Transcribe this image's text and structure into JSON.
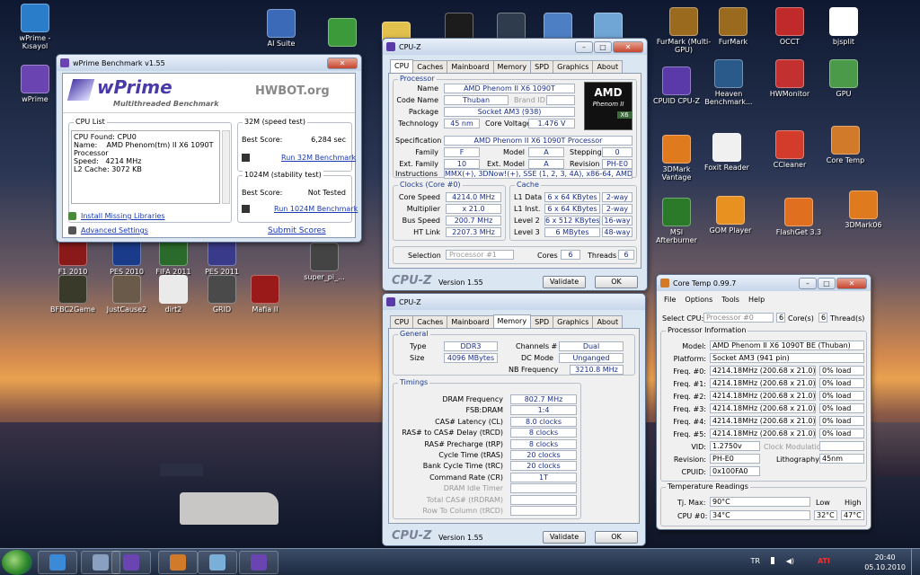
{
  "desktop_icons": [
    {
      "name": "wprime-kisayol-icon",
      "label": "wPrime - Kısayol",
      "color": "#2a7dc9"
    },
    {
      "name": "wprime-icon",
      "label": "wPrime",
      "color": "#6a44b0"
    },
    {
      "name": "ai-suite-icon",
      "label": "AI Suite",
      "color": "#3a6ab8"
    },
    {
      "name": "chrome-icon",
      "label": "",
      "color": "#3d9a3a"
    },
    {
      "name": "folder-icon",
      "label": "",
      "color": "#e2c14c"
    },
    {
      "name": "amd-icon",
      "label": "",
      "color": "#1c1c1c"
    },
    {
      "name": "steam-icon",
      "label": "",
      "color": "#2f3c4e"
    },
    {
      "name": "app-icon-1",
      "label": "",
      "color": "#4d7fc4"
    },
    {
      "name": "app-icon-2",
      "label": "",
      "color": "#70a6d6"
    },
    {
      "name": "furmark-multi-gpu-icon",
      "label": "FurMark (Multi-GPU)",
      "color": "#9a6a1e"
    },
    {
      "name": "furmark-icon",
      "label": "FurMark",
      "color": "#9a6a1e"
    },
    {
      "name": "occt-icon",
      "label": "OCCT",
      "color": "#c12a2a"
    },
    {
      "name": "bjsplit-icon",
      "label": "bjsplit",
      "color": "#ffffff"
    },
    {
      "name": "cpu-z-icon",
      "label": "CPUID CPU-Z",
      "color": "#5a3aa8"
    },
    {
      "name": "heaven-benchmark-icon",
      "label": "Heaven Benchmark...",
      "color": "#2a5a8a"
    },
    {
      "name": "hwmonitor-icon",
      "label": "HWMonitor",
      "color": "#c23030"
    },
    {
      "name": "gpu-icon",
      "label": "GPU",
      "color": "#4a9a4a"
    },
    {
      "name": "3dmark-vantage-icon",
      "label": "3DMark Vantage",
      "color": "#e07a1e"
    },
    {
      "name": "foxit-reader-icon",
      "label": "Foxit Reader",
      "color": "#f0f0f0"
    },
    {
      "name": "ccleaner-icon",
      "label": "CCleaner",
      "color": "#d33b2a"
    },
    {
      "name": "core-temp-icon",
      "label": "Core Temp",
      "color": "#d07a2a"
    },
    {
      "name": "msi-afterburner-icon",
      "label": "MSI Afterburner",
      "color": "#2a7a2a"
    },
    {
      "name": "gom-player-icon",
      "label": "GOM Player",
      "color": "#e89020"
    },
    {
      "name": "flashget-icon",
      "label": "FlashGet 3.3",
      "color": "#e07020"
    },
    {
      "name": "3dmark06-icon",
      "label": "3DMark06",
      "color": "#e07a1e"
    },
    {
      "name": "f1-2010-icon",
      "label": "F1 2010",
      "color": "#8a1a1a"
    },
    {
      "name": "pes-2010-icon",
      "label": "PES 2010",
      "color": "#1a3a8a"
    },
    {
      "name": "fifa-2011-icon",
      "label": "FIFA 2011",
      "color": "#2a6a2a"
    },
    {
      "name": "pes-2011-icon",
      "label": "PES 2011",
      "color": "#3a3a8a"
    },
    {
      "name": "super-pi-icon",
      "label": "super_pi_...",
      "color": "#444"
    },
    {
      "name": "bfbc2game-icon",
      "label": "BFBC2Game",
      "color": "#3a3a2a"
    },
    {
      "name": "justcause2-icon",
      "label": "JustCause2",
      "color": "#6a5a4a"
    },
    {
      "name": "dirt2-icon",
      "label": "dirt2",
      "color": "#eaeaea"
    },
    {
      "name": "grid-icon",
      "label": "GRID",
      "color": "#4a4a4a"
    },
    {
      "name": "mafia-ii-icon",
      "label": "Mafia II",
      "color": "#9a1a1a"
    }
  ],
  "wprime": {
    "title": "wPrime Benchmark v1.55",
    "logo": "wPrime",
    "logo_sub": "Multithreaded Benchmark",
    "hwbot": "HWBOT.org",
    "cpu_list_label": "CPU List",
    "cpu_lines": [
      "CPU Found: CPU0",
      "Name:    AMD Phenom(tm) II X6 1090T",
      "Processor",
      "Speed:   4214 MHz",
      "L2 Cache: 3072 KB"
    ],
    "speed_test_label": "32M (speed test)",
    "stability_test_label": "1024M (stability test)",
    "best_score_label": "Best Score:",
    "best_32m": "6,284 sec",
    "best_1024m": "Not Tested",
    "run_32m": "Run 32M Benchmark",
    "run_1024m": "Run 1024M Benchmark",
    "install_libs": "Install Missing Libraries",
    "advanced": "Advanced Settings",
    "submit": "Submit Scores"
  },
  "cpuz1": {
    "title": "CPU-Z",
    "tabs": [
      "CPU",
      "Caches",
      "Mainboard",
      "Memory",
      "SPD",
      "Graphics",
      "About"
    ],
    "processor_label": "Processor",
    "name_label": "Name",
    "name": "AMD Phenom II X6 1090T",
    "codename_label": "Code Name",
    "codename": "Thuban",
    "brandid_label": "Brand ID",
    "package_label": "Package",
    "package": "Socket AM3 (938)",
    "tech_label": "Technology",
    "tech": "45 nm",
    "voltage_label": "Core Voltage",
    "voltage": "1.476 V",
    "spec_label": "Specification",
    "spec": "AMD Phenom II X6 1090T Processor",
    "family_label": "Family",
    "family": "F",
    "model_label": "Model",
    "model": "A",
    "stepping_label": "Stepping",
    "stepping": "0",
    "extfamily_label": "Ext. Family",
    "extfamily": "10",
    "extmodel_label": "Ext. Model",
    "extmodel": "A",
    "revision_label": "Revision",
    "revision": "PH-E0",
    "instr_label": "Instructions",
    "instr": "MMX(+), 3DNow!(+), SSE (1, 2, 3, 4A), x86-64, AMD-V",
    "amd_logo": "AMD",
    "phenom_logo": "Phenom II",
    "x6": "X6",
    "clocks_label": "Clocks (Core #0)",
    "corespeed_label": "Core Speed",
    "corespeed": "4214.0 MHz",
    "multiplier_label": "Multiplier",
    "multiplier": "x 21.0",
    "busspeed_label": "Bus Speed",
    "busspeed": "200.7 MHz",
    "htlink_label": "HT Link",
    "htlink": "2207.3 MHz",
    "cache_label": "Cache",
    "l1d_label": "L1 Data",
    "l1d": "6 x 64 KBytes",
    "l1d_w": "2-way",
    "l1i_label": "L1 Inst.",
    "l1i": "6 x 64 KBytes",
    "l1i_w": "2-way",
    "l2_label": "Level 2",
    "l2": "6 x 512 KBytes",
    "l2_w": "16-way",
    "l3_label": "Level 3",
    "l3": "6 MBytes",
    "l3_w": "48-way",
    "selection_label": "Selection",
    "selection": "Processor #1",
    "cores_label": "Cores",
    "cores": "6",
    "threads_label": "Threads",
    "threads": "6",
    "brand": "CPU-Z",
    "version": "Version 1.55",
    "validate": "Validate",
    "ok": "OK"
  },
  "cpuz2": {
    "title": "CPU-Z",
    "tabs": [
      "CPU",
      "Caches",
      "Mainboard",
      "Memory",
      "SPD",
      "Graphics",
      "About"
    ],
    "general_label": "General",
    "type_label": "Type",
    "type": "DDR3",
    "size_label": "Size",
    "size": "4096 MBytes",
    "channels_label": "Channels #",
    "channels": "Dual",
    "dcmode_label": "DC Mode",
    "dcmode": "Unganged",
    "nbfreq_label": "NB Frequency",
    "nbfreq": "3210.8 MHz",
    "timings_label": "Timings",
    "timings": [
      {
        "label": "DRAM Frequency",
        "value": "802.7 MHz"
      },
      {
        "label": "FSB:DRAM",
        "value": "1:4"
      },
      {
        "label": "CAS# Latency (CL)",
        "value": "8.0 clocks"
      },
      {
        "label": "RAS# to CAS# Delay (tRCD)",
        "value": "8 clocks"
      },
      {
        "label": "RAS# Precharge (tRP)",
        "value": "8 clocks"
      },
      {
        "label": "Cycle Time (tRAS)",
        "value": "20 clocks"
      },
      {
        "label": "Bank Cycle Time (tRC)",
        "value": "20 clocks"
      },
      {
        "label": "Command Rate (CR)",
        "value": "1T"
      },
      {
        "label": "DRAM Idle Timer",
        "value": ""
      },
      {
        "label": "Total CAS# (tRDRAM)",
        "value": ""
      },
      {
        "label": "Row To Column (tRCD)",
        "value": ""
      }
    ],
    "brand": "CPU-Z",
    "version": "Version 1.55",
    "validate": "Validate",
    "ok": "OK"
  },
  "coretemp": {
    "title": "Core Temp 0.99.7",
    "menu": [
      "File",
      "Options",
      "Tools",
      "Help"
    ],
    "selectcpu_label": "Select CPU:",
    "selectcpu": "Processor #0",
    "cores_n": "6",
    "cores_label": "Core(s)",
    "threads_n": "6",
    "threads_label": "Thread(s)",
    "procinfo_label": "Processor Information",
    "model_label": "Model:",
    "model": "AMD Phenom II X6 1090T BE (Thuban)",
    "platform_label": "Platform:",
    "platform": "Socket AM3 (941 pin)",
    "freqs": [
      {
        "label": "Freq. #0:",
        "value": "4214.18MHz (200.68 x 21.0)",
        "load": "0% load"
      },
      {
        "label": "Freq. #1:",
        "value": "4214.18MHz (200.68 x 21.0)",
        "load": "0% load"
      },
      {
        "label": "Freq. #2:",
        "value": "4214.18MHz (200.68 x 21.0)",
        "load": "0% load"
      },
      {
        "label": "Freq. #3:",
        "value": "4214.18MHz (200.68 x 21.0)",
        "load": "0% load"
      },
      {
        "label": "Freq. #4:",
        "value": "4214.18MHz (200.68 x 21.0)",
        "load": "0% load"
      },
      {
        "label": "Freq. #5:",
        "value": "4214.18MHz (200.68 x 21.0)",
        "load": "0% load"
      }
    ],
    "vid_label": "VID:",
    "vid": "1.2750v",
    "clockmod_label": "Clock Modulation:",
    "revision_label": "Revision:",
    "revision": "PH-E0",
    "litho_label": "Lithography:",
    "litho": "45nm",
    "cpuid_label": "CPUID:",
    "cpuid": "0x100FA0",
    "temps_label": "Temperature Readings",
    "tjmax_label": "Tj. Max:",
    "tjmax": "90°C",
    "low_label": "Low",
    "high_label": "High",
    "cpu0_label": "CPU #0:",
    "cpu0": "34°C",
    "low": "32°C",
    "high": "47°C"
  },
  "taskbar": {
    "buttons": [
      {
        "name": "taskbar-ie",
        "color": "#3a8ad8"
      },
      {
        "name": "taskbar-calculator",
        "color": "#8aa0c0"
      },
      {
        "name": "taskbar-cpu-z",
        "color": "#6a44b0"
      },
      {
        "name": "taskbar-core-temp",
        "color": "#d07a2a"
      },
      {
        "name": "taskbar-app",
        "color": "#7ab0d8"
      },
      {
        "name": "taskbar-wprime",
        "color": "#6a44b0"
      }
    ],
    "lang": "TR",
    "time": "20:40",
    "date": "05.10.2010"
  }
}
